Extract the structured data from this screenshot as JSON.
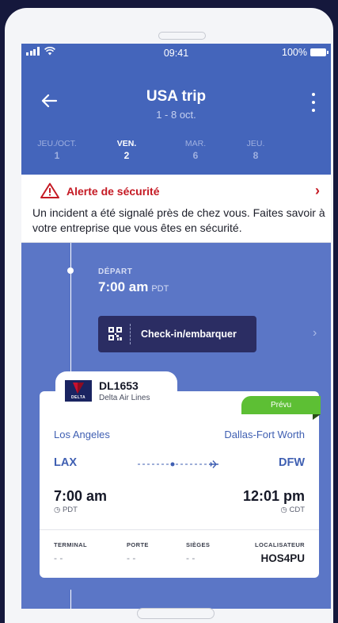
{
  "status_bar": {
    "time": "09:41",
    "battery": "100%"
  },
  "header": {
    "title": "USA trip",
    "dates": "1 - 8 oct.",
    "days": [
      {
        "label": "JEU./OCT.",
        "num": "1"
      },
      {
        "label": "VEN.",
        "num": "2",
        "active": true
      },
      {
        "label": "MAR.",
        "num": "6"
      },
      {
        "label": "JEU.",
        "num": "8"
      }
    ]
  },
  "alert": {
    "title": "Alerte de sécurité",
    "body": "Un incident a été signalé près de chez vous. Faites savoir à votre entreprise que vous êtes en sécurité."
  },
  "departure": {
    "label": "DÉPART",
    "time": "7:00 am",
    "tz": "PDT",
    "checkin_label": "Check-in/embarquer"
  },
  "flight": {
    "number": "DL1653",
    "airline": "Delta Air Lines",
    "logo_text": "DELTA",
    "status": "Prévu",
    "origin_city": "Los Angeles",
    "dest_city": "Dallas-Fort Worth",
    "origin_code": "LAX",
    "dest_code": "DFW",
    "depart_time": "7:00 am",
    "depart_tz": "PDT",
    "arrive_time": "12:01 pm",
    "arrive_tz": "CDT",
    "info": [
      {
        "label": "TERMINAL",
        "value": "- -"
      },
      {
        "label": "PORTE",
        "value": "- -"
      },
      {
        "label": "SIÈGES",
        "value": "- -"
      },
      {
        "label": "LOCALISATEUR",
        "value": "HOS4PU"
      }
    ]
  },
  "colors": {
    "header": "#4465bb",
    "background": "#5b76c6",
    "alert": "#c51a24",
    "badge": "#5dbf34",
    "checkin": "#2b2d63"
  }
}
